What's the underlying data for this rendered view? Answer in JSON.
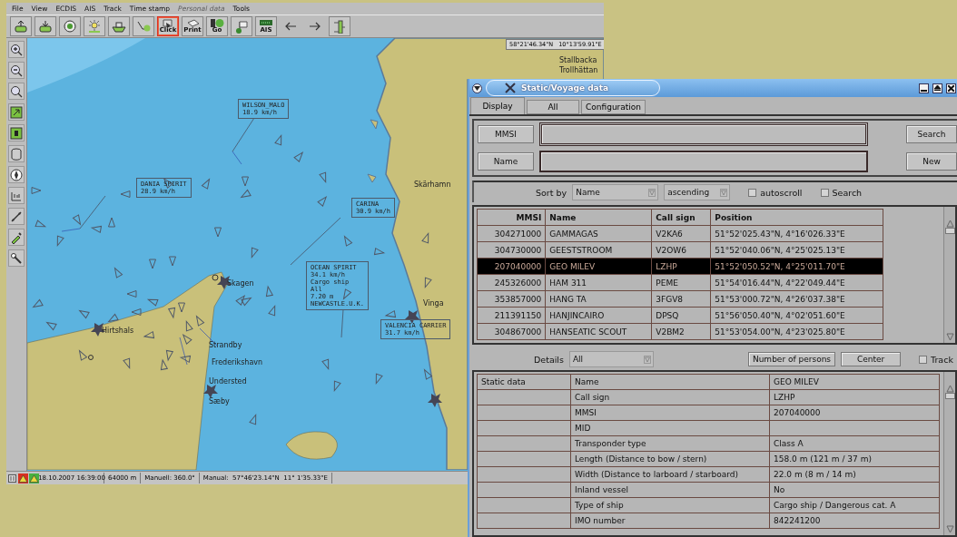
{
  "chart_window": {
    "menu": [
      {
        "label": "File",
        "disabled": false
      },
      {
        "label": "View",
        "disabled": false
      },
      {
        "label": "ECDIS",
        "disabled": false
      },
      {
        "label": "AIS",
        "disabled": false
      },
      {
        "label": "Track",
        "disabled": false
      },
      {
        "label": "Time stamp",
        "disabled": false
      },
      {
        "label": "Personal data",
        "disabled": true
      },
      {
        "label": "Tools",
        "disabled": false
      }
    ],
    "toolbar": [
      {
        "kind": "icon",
        "selected": false
      },
      {
        "kind": "icon",
        "selected": false
      },
      {
        "kind": "icon",
        "selected": false
      },
      {
        "kind": "icon",
        "selected": false
      },
      {
        "kind": "icon",
        "selected": false
      },
      {
        "kind": "icon",
        "selected": false
      },
      {
        "kind": "labeled",
        "label": "Click",
        "selected": true
      },
      {
        "kind": "labeled",
        "label": "Print",
        "selected": false
      },
      {
        "kind": "labeled",
        "label": "Go",
        "selected": false
      },
      {
        "kind": "icon",
        "selected": false
      },
      {
        "kind": "labeled",
        "label": "AIS",
        "selected": false
      },
      {
        "kind": "arrow",
        "selected": false
      },
      {
        "kind": "arrow",
        "selected": false
      },
      {
        "kind": "icon",
        "selected": false
      }
    ],
    "map": {
      "position_readout": "58°21'46.34\"N   10°13'59.91\"E",
      "vessel_labels": [
        {
          "lines": [
            "WILSON_MALO",
            "18.9 km/h"
          ]
        },
        {
          "lines": [
            "DANIA SPIRIT",
            "28.9 km/h"
          ]
        },
        {
          "lines": [
            "CARINA",
            "30.9 km/h"
          ]
        },
        {
          "lines": [
            "OCEAN SPIRIT",
            "34.1 km/h",
            "Cargo ship",
            "All",
            "7.20 m",
            "NEWCASTLE.U.K."
          ]
        },
        {
          "lines": [
            "VALENCIA CARRIER",
            "31.7 km/h"
          ]
        }
      ],
      "place_labels": [
        "Skagen",
        "Hirtshals",
        "Strandby",
        "Frederikshavn",
        "Understed",
        "Sæby",
        "Skärhamn",
        "Vinga",
        "Stallbacka",
        "Trollhättan"
      ]
    },
    "status_bar": {
      "alarms": [
        {
          "color": "#d83020"
        },
        {
          "color": "#48b040"
        }
      ],
      "fields": [
        "18.10.2007 16:39:00",
        "64000 m",
        "Manuell: 360.0°",
        "Manual:  57°46'23.14\"N  11° 1'35.33\"E"
      ]
    }
  },
  "dialog": {
    "title": "Static/Voyage data",
    "tabs": [
      {
        "label": "Display",
        "selected": true
      },
      {
        "label": "All",
        "selected": false
      },
      {
        "label": "Configuration",
        "selected": false
      }
    ],
    "search": {
      "mmsi_label": "MMSI",
      "name_label": "Name",
      "search_button": "Search",
      "new_button": "New"
    },
    "sort": {
      "label": "Sort by",
      "field": "Name",
      "order": "ascending",
      "options": [
        {
          "label": "autoscroll",
          "checked": false
        },
        {
          "label": "Search",
          "checked": false
        }
      ]
    },
    "table": {
      "columns": [
        "MMSI",
        "Name",
        "Call sign",
        "Position"
      ],
      "rows": [
        {
          "cells": [
            "304271000",
            "GAMMAGAS",
            "V2KA6",
            "51°52'025.43\"N,  4°16'026.33\"E"
          ],
          "selected": false
        },
        {
          "cells": [
            "304730000",
            "GEESTSTROOM",
            "V2OW6",
            "51°52'040.06\"N,  4°25'025.13\"E"
          ],
          "selected": false
        },
        {
          "cells": [
            "207040000",
            "GEO MILEV",
            "LZHP",
            "51°52'050.52\"N,  4°25'011.70\"E"
          ],
          "selected": true
        },
        {
          "cells": [
            "245326000",
            "HAM 311",
            "PEME",
            "51°54'016.44\"N,  4°22'049.44\"E"
          ],
          "selected": false
        },
        {
          "cells": [
            "353857000",
            "HANG TA",
            "3FGV8",
            "51°53'000.72\"N,  4°26'037.38\"E"
          ],
          "selected": false
        },
        {
          "cells": [
            "211391150",
            "HANJINCAIRO",
            "DPSQ",
            "51°56'050.40\"N,  4°02'051.60\"E"
          ],
          "selected": false
        },
        {
          "cells": [
            "304867000",
            "HANSEATIC SCOUT",
            "V2BM2",
            "51°53'054.00\"N,  4°23'025.80\"E"
          ],
          "selected": false
        }
      ]
    },
    "details": {
      "label": "Details",
      "filter": "All",
      "buttons": [
        "Number of persons",
        "Center"
      ],
      "track": {
        "label": "Track",
        "checked": false
      },
      "rows": [
        {
          "group": "Static data",
          "field": "Name",
          "value": "GEO MILEV"
        },
        {
          "field": "Call sign",
          "value": "LZHP"
        },
        {
          "field": "MMSI",
          "value": "207040000"
        },
        {
          "field": "MID"
        },
        {
          "field": "Transponder type",
          "value": "Class A"
        },
        {
          "field": "Length (Distance to bow / stern)",
          "value": "158.0 m (121 m / 37 m)"
        },
        {
          "field": "Width (Distance to larboard / starboard)",
          "value": "22.0 m (8 m / 14 m)"
        },
        {
          "field": "Inland vessel",
          "value": "No"
        },
        {
          "field": "Type of ship",
          "value": "Cargo ship / Dangerous cat. A"
        },
        {
          "field": "IMO number",
          "value": "842241200"
        }
      ]
    }
  }
}
